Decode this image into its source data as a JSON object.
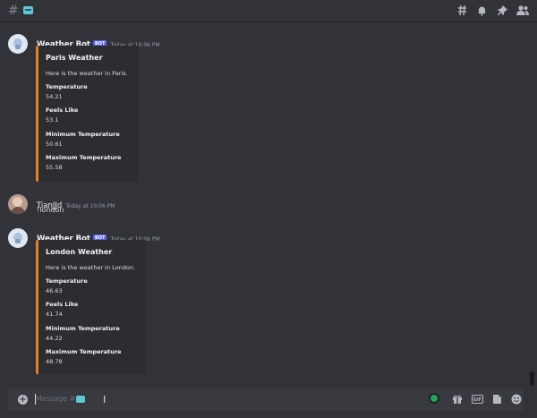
{
  "header": {
    "hash_symbol": "#",
    "channel_emoji": "channel-emoji-icon",
    "icons": [
      "threads-icon",
      "bell-icon",
      "pin-icon",
      "members-icon"
    ]
  },
  "messages": [
    {
      "author": "Weather Bot",
      "bot_tag": "BOT",
      "timestamp": "Today at 10:06 PM",
      "embed": {
        "title": "Paris Weather",
        "description": "Here is the weather in Paris.",
        "fields": [
          {
            "name": "Temperature",
            "value": "54.21"
          },
          {
            "name": "Feels Like",
            "value": "53.1"
          },
          {
            "name": "Minimum Temperature",
            "value": "50.61"
          },
          {
            "name": "Maximum Temperature",
            "value": "55.58"
          }
        ]
      }
    },
    {
      "author": "TianJJd",
      "timestamp": "Today at 10:06 PM",
      "text": "!london"
    },
    {
      "author": "Weather Bot",
      "bot_tag": "BOT",
      "timestamp": "Today at 10:06 PM",
      "embed": {
        "title": "London Weather",
        "description": "Here is the weather in London.",
        "fields": [
          {
            "name": "Temperature",
            "value": "46.63"
          },
          {
            "name": "Feels Like",
            "value": "41.74"
          },
          {
            "name": "Minimum Temperature",
            "value": "44.22"
          },
          {
            "name": "Maximum Temperature",
            "value": "48.78"
          }
        ]
      }
    }
  ],
  "composer": {
    "placeholder": "Message #",
    "gif_label": "GIF",
    "icons": [
      "plus-circle-icon",
      "gift-icon",
      "gif-icon",
      "sticker-icon",
      "emoji-icon"
    ]
  },
  "colors": {
    "background": "#313338",
    "embed_bg": "#2b2d31",
    "embed_accent": "#e67e22",
    "bot_tag": "#5865f2"
  }
}
